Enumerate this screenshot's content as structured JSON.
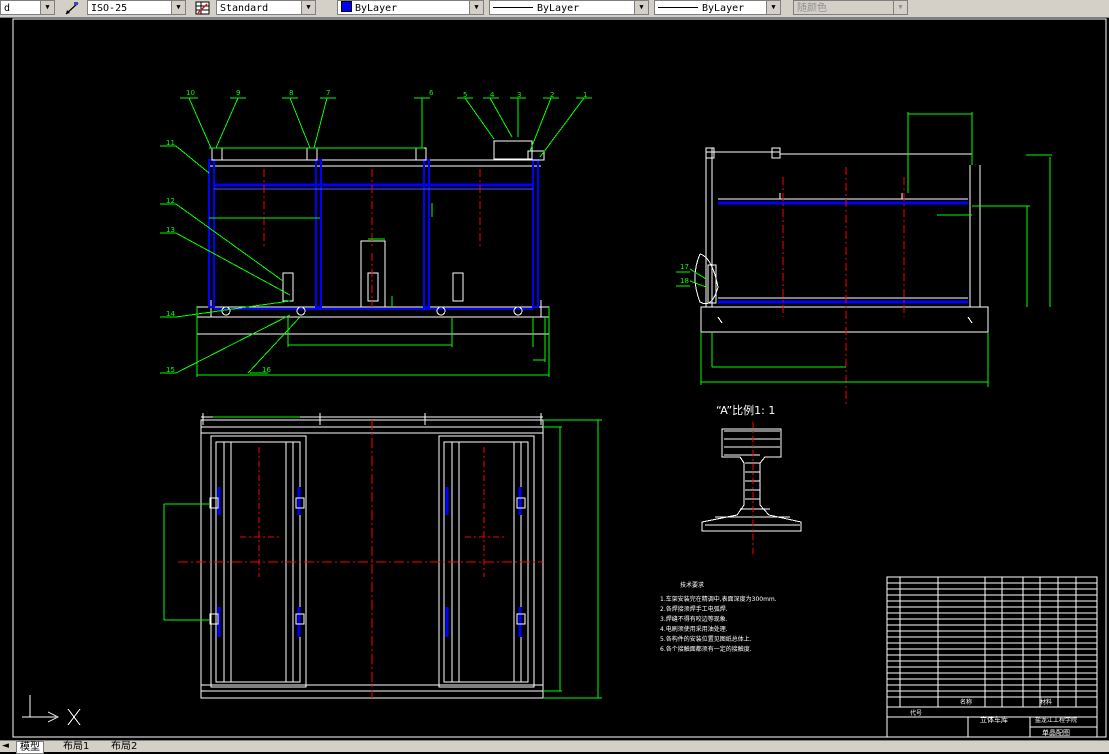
{
  "toolbar": {
    "text_style": "d",
    "dim_style": "ISO-25",
    "table_style": "Standard",
    "layer_color": "ByLayer",
    "linetype": "ByLayer",
    "lineweight": "ByLayer",
    "plot_style": "随颜色"
  },
  "tabs": {
    "model": "模型",
    "layout1": "布局1",
    "layout2": "布局2"
  },
  "drawing": {
    "balloons": {
      "b10": "10",
      "b9a": "9",
      "b8": "8",
      "b7": "7",
      "b6": "6",
      "b5": "5",
      "b4": "4",
      "b3": "3",
      "b2": "2",
      "b1": "1",
      "b11": "11",
      "b12": "12",
      "b13": "13",
      "b14": "14",
      "b15": "15",
      "b16": "16",
      "b17": "17",
      "b18": "18"
    },
    "detail_title": "“A”比例1: 1",
    "tech_notes": {
      "title": "技术要求",
      "lines": [
        "1.车架安装完在精调中,表面深度为300mm.",
        "2.各焊接须焊手工电弧焊.",
        "3.焊缝不得有咬边等现象.",
        "4.电刷须使用采用油处理.",
        "5.各构件的安装位置见图纸总体上.",
        "6.各个接触面都须有一定的接触度."
      ]
    },
    "title_block": {
      "name_label": "名称",
      "code_label": "代号",
      "material_label": "材料",
      "part_name": "立体车库",
      "sheet_name": "单晶配图",
      "school": "盐龙江工程学院"
    }
  },
  "colors": {
    "drawing_bg": "#000000",
    "frame": "#ffffff",
    "structure": "#0000ff",
    "centerline": "#ff0000",
    "dimension": "#00ff00",
    "ui_face": "#d4d0c8"
  }
}
